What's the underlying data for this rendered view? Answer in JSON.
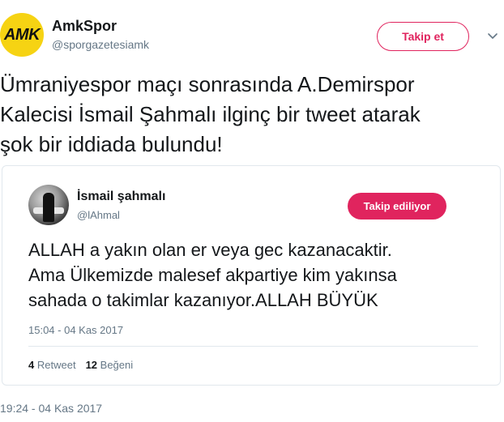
{
  "author": {
    "avatar_text": "AMK",
    "display_name": "AmkSpor",
    "handle": "@sporgazetesiamk",
    "follow_label": "Takip et",
    "avatar_color": "#f6d313"
  },
  "tweet": {
    "text": "Ümraniyespor maçı sonrasında A.Demirspor\nKalecisi İsmail Şahmalı ilginç bir tweet atarak\nşok bir iddiada bulundu!",
    "timestamp": "19:24 - 04 Kas 2017"
  },
  "quoted": {
    "display_name": "İsmail şahmalı",
    "handle": "@lAhmal",
    "following_label": "Takip ediliyor",
    "text": "ALLAH  a yakın olan er veya gec kazanacaktir.\nAma Ülkemizde malesef akpartiye kim yakınsa\nsahada o takimlar kazanıyor.ALLAH BÜYÜK",
    "timestamp": "15:04 - 04 Kas 2017",
    "retweet_count": "4",
    "retweet_label": "Retweet",
    "like_count": "12",
    "like_label": "Beğeni"
  },
  "colors": {
    "accent": "#e0245e",
    "muted": "#657786",
    "border": "#e1e8ed"
  },
  "icons": {
    "menu": "chevron-down-icon"
  }
}
